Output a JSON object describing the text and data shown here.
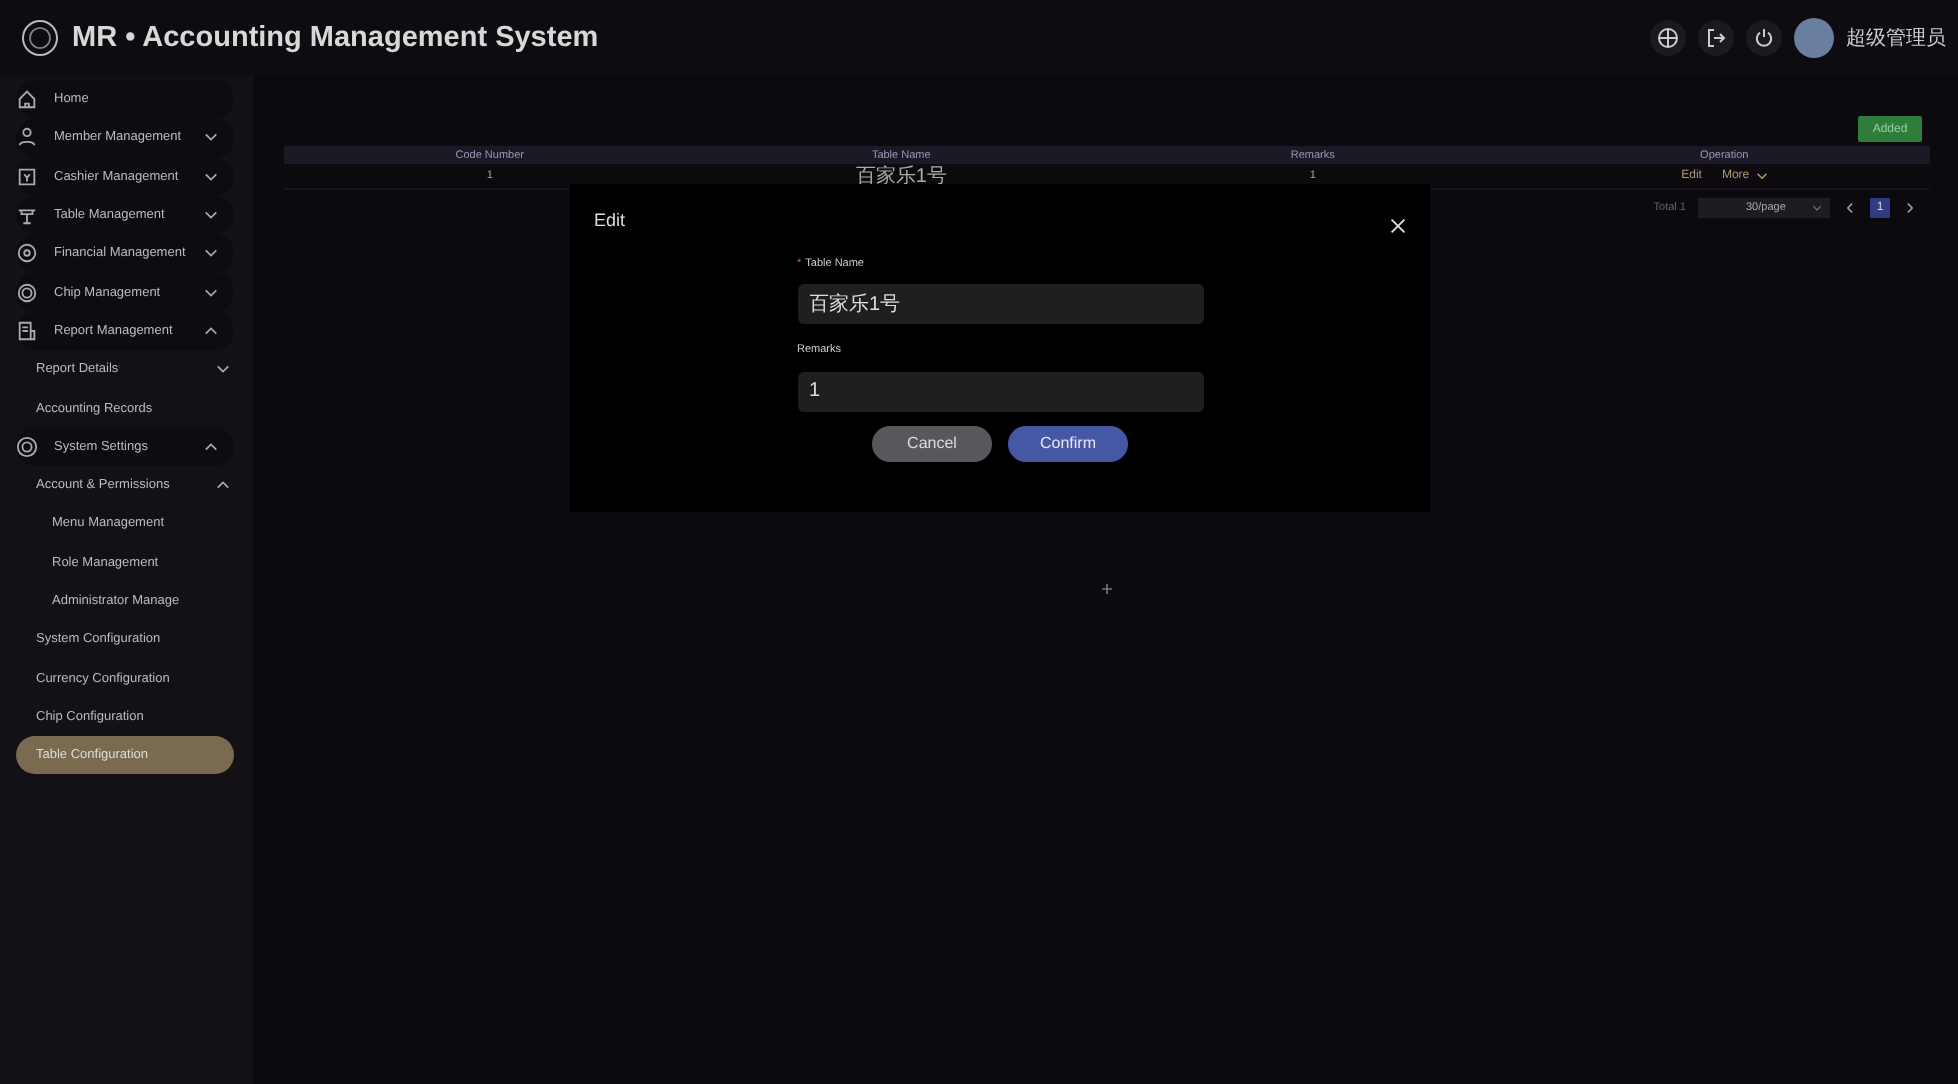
{
  "header": {
    "title": "MR • Accounting Management System",
    "user": "超级管理员"
  },
  "sidebar": {
    "items": [
      {
        "label": "Home",
        "selected": false
      },
      {
        "label": "Member Management",
        "selected": false,
        "expanded": false
      },
      {
        "label": "Cashier Management",
        "selected": false,
        "expanded": false
      },
      {
        "label": "Table Management",
        "selected": false,
        "expanded": false
      },
      {
        "label": "Financial Management",
        "selected": false,
        "expanded": false
      },
      {
        "label": "Chip Management",
        "selected": false,
        "expanded": false
      },
      {
        "label": "Report Management",
        "selected": false,
        "expanded": true,
        "children": [
          {
            "label": "Report Details",
            "selected": false,
            "expanded": false
          },
          {
            "label": "Accounting Records",
            "selected": false
          }
        ]
      },
      {
        "label": "System Settings",
        "selected": false,
        "expanded": true,
        "children": [
          {
            "label": "Account & Permissions",
            "selected": false,
            "expanded": true,
            "children": [
              {
                "label": "Menu Management",
                "selected": false
              },
              {
                "label": "Role Management",
                "selected": false
              },
              {
                "label": "Administrator Manage",
                "selected": false
              }
            ]
          },
          {
            "label": "System Configuration",
            "selected": false
          },
          {
            "label": "Currency Configuration",
            "selected": false
          },
          {
            "label": "Chip Configuration",
            "selected": false
          },
          {
            "label": "Table Configuration",
            "selected": true
          }
        ]
      }
    ]
  },
  "toolbar": {
    "add_button": "Added"
  },
  "table": {
    "columns": [
      "Code Number",
      "Table Name",
      "Remarks",
      "Operation"
    ],
    "rows": [
      {
        "cells": [
          "1",
          "百家乐1号",
          "1"
        ],
        "actions": [
          "Edit",
          "More"
        ]
      }
    ]
  },
  "pagination": {
    "total": "Total 1",
    "page_size": "30/page",
    "pages": [
      {
        "label": "1",
        "selected": true
      }
    ]
  },
  "dialog": {
    "title": "Edit",
    "fields": [
      {
        "label": "Table Name",
        "required_mark": "*",
        "value": "百家乐1号"
      },
      {
        "label": "Remarks",
        "value": "1"
      }
    ],
    "buttons": [
      {
        "label": "Cancel",
        "kind": "secondary"
      },
      {
        "label": "Confirm",
        "kind": "primary"
      }
    ]
  }
}
